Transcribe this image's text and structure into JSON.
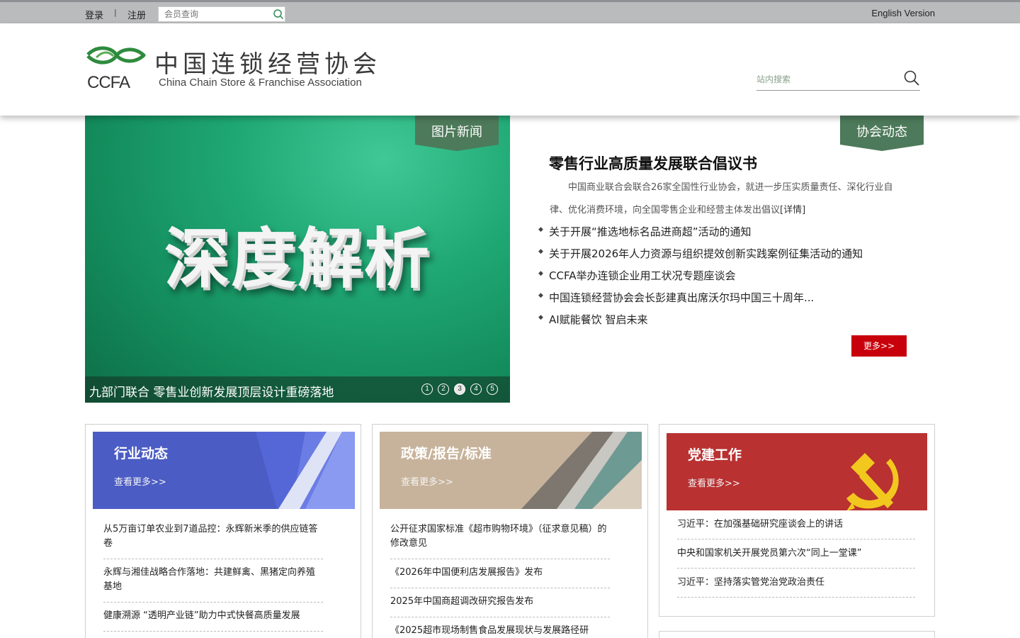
{
  "topbar": {
    "login": "登录",
    "separator": "|",
    "register": "注册",
    "member_search_placeholder": "会员查询",
    "english": "English Version"
  },
  "header": {
    "logo_cn": "中国连锁经营协会",
    "logo_en": "China Chain Store & Franchise Association",
    "logo_abbr": "CCFA",
    "site_search_placeholder": "站内搜索"
  },
  "slider": {
    "tab": "图片新闻",
    "headline": "深度解析",
    "caption": "九部门联合 零售业创新发展顶层设计重磅落地",
    "dots": [
      "1",
      "2",
      "3",
      "4",
      "5"
    ],
    "active_dot": 3
  },
  "assoc": {
    "tab": "协会动态",
    "title": "零售行业高质量发展联合倡议书",
    "summary": "中国商业联合会联合26家全国性行业协会，就进一步压实质量责任、深化行业自律、优化消费环境，向全国零售企业和经营主体发出倡议",
    "detail": "[详情]",
    "items": [
      "关于开展“推选地标名品进商超”活动的通知",
      "关于开展2026年人力资源与组织提效创新实践案例征集活动的通知",
      "CCFA举办连锁企业用工状况专题座谈会",
      "中国连锁经营协会会长彭建真出席沃尔玛中国三十周年...",
      "AI赋能餐饮 智启未来"
    ],
    "more": "更多>>"
  },
  "columns": [
    {
      "title": "行业动态",
      "more": "查看更多>>",
      "color": "#4b5cc4",
      "items": [
        "从5万亩订单农业到7道品控：永辉新米季的供应链答卷",
        "永辉与湘佳战略合作落地：共建鲜禽、黑猪定向养殖基地",
        "健康溯源 “透明产业链”助力中式快餐高质量发展"
      ]
    },
    {
      "title": "政策/报告/标准",
      "more": "查看更多>>",
      "color": "#c7b39b",
      "items": [
        "公开征求国家标准《超市购物环境》（征求意见稿）的修改意见",
        "《2026年中国便利店发展报告》发布",
        "2025年中国商超调改研究报告发布",
        "《2025超市现场制售食品发展现状与发展路径研"
      ]
    },
    {
      "title": "党建工作",
      "more": "查看更多>>",
      "color": "#b93131",
      "items": [
        "习近平：在加强基础研究座谈会上的讲话",
        "中央和国家机关开展党员第六次“同上一堂课”",
        "习近平：坚持落实管党治党政治责任"
      ]
    }
  ]
}
